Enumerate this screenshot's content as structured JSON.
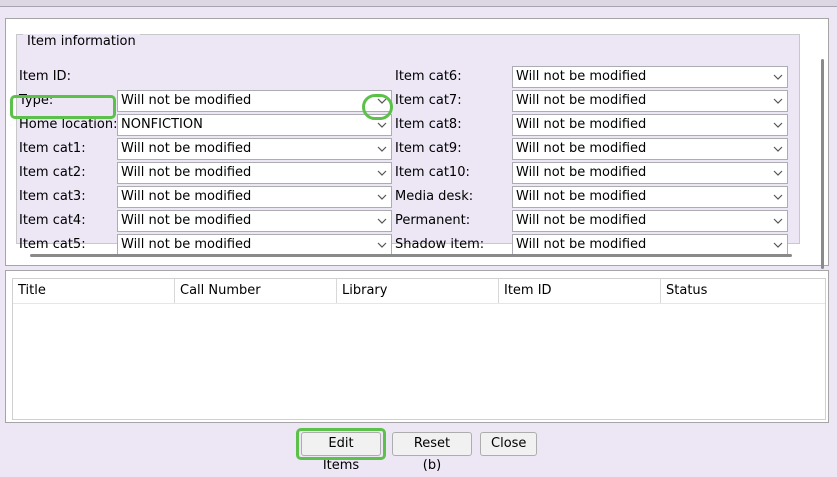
{
  "group_title": "Item information",
  "left_fields": [
    {
      "label": "Item ID:",
      "value": null
    },
    {
      "label": "Type:",
      "value": "Will not be modified"
    },
    {
      "label": "Home location:",
      "value": "NONFICTION"
    },
    {
      "label": "Item cat1:",
      "value": "Will not be modified"
    },
    {
      "label": "Item cat2:",
      "value": "Will not be modified"
    },
    {
      "label": "Item cat3:",
      "value": "Will not be modified"
    },
    {
      "label": "Item cat4:",
      "value": "Will not be modified"
    },
    {
      "label": "Item cat5:",
      "value": "Will not be modified"
    }
  ],
  "right_fields": [
    {
      "label": "Item cat6:",
      "value": "Will not be modified"
    },
    {
      "label": "Item cat7:",
      "value": "Will not be modified"
    },
    {
      "label": "Item cat8:",
      "value": "Will not be modified"
    },
    {
      "label": "Item cat9:",
      "value": "Will not be modified"
    },
    {
      "label": "Item cat10:",
      "value": "Will not be modified"
    },
    {
      "label": "Media desk:",
      "value": "Will not be modified"
    },
    {
      "label": "Permanent:",
      "value": "Will not be modified"
    },
    {
      "label": "Shadow item:",
      "value": "Will not be modified"
    }
  ],
  "table": {
    "columns": [
      "Title",
      "Call Number",
      "Library",
      "Item ID",
      "Status"
    ],
    "rows": []
  },
  "buttons": {
    "edit": "Edit Items",
    "reset": "Reset (b)",
    "close": "Close"
  },
  "colors": {
    "highlight": "#5cc14a",
    "panel_background": "#ece6f5"
  },
  "icons": {
    "dropdown": "chevron-down-icon"
  }
}
